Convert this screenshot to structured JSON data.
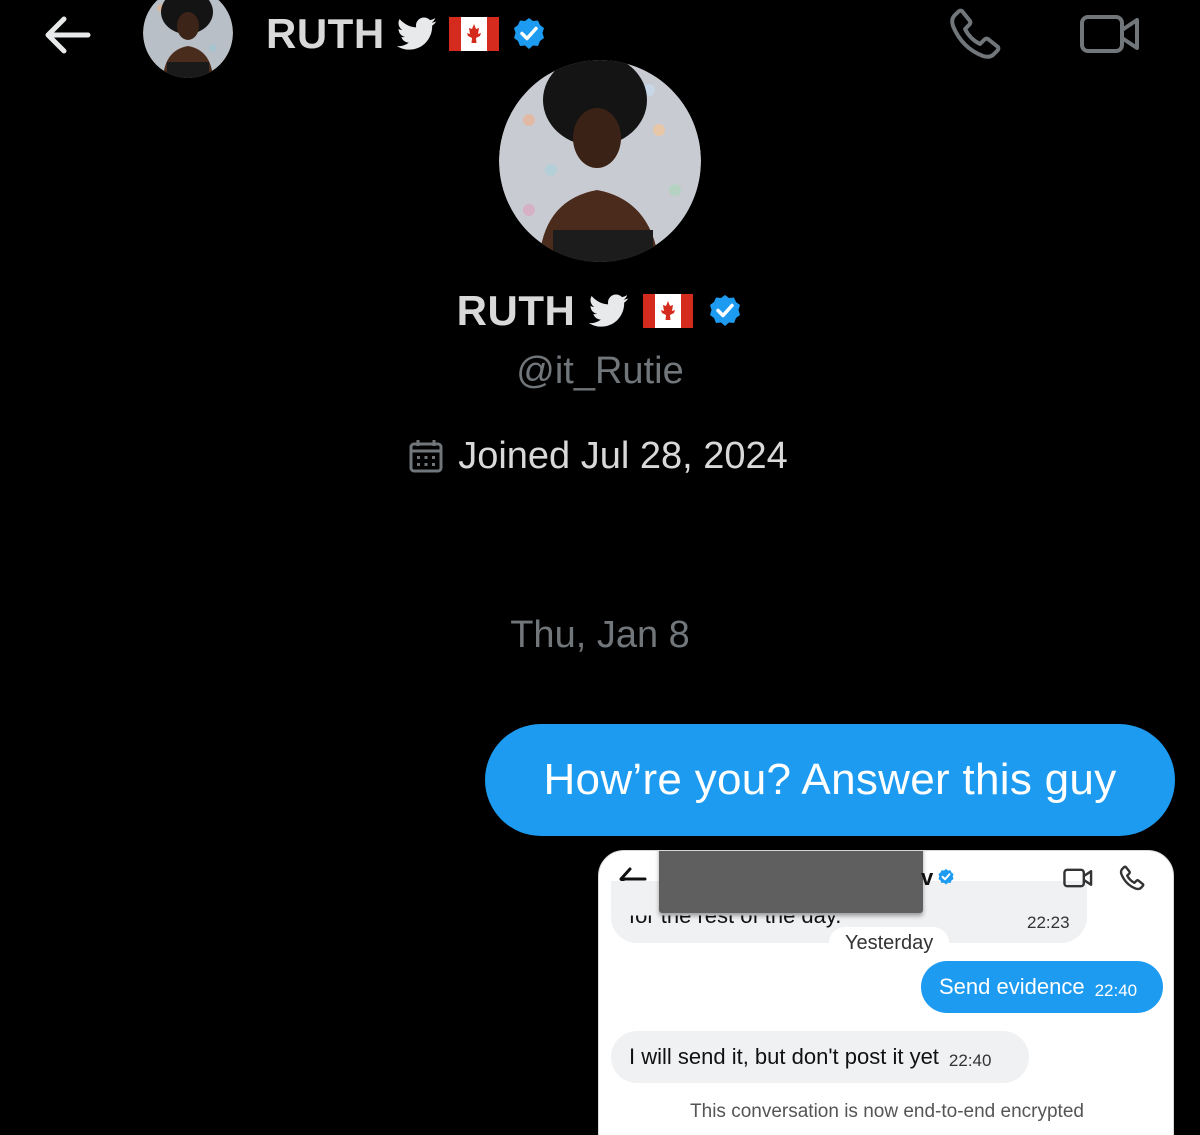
{
  "header": {
    "back_icon": "arrow-left-icon",
    "name": "RUTH",
    "badges": [
      "twitter-bird-icon",
      "canada-flag-icon",
      "verified-badge-icon"
    ],
    "call_icon": "phone-icon",
    "video_icon": "video-camera-icon"
  },
  "profile": {
    "name": "RUTH",
    "handle": "@it_Rutie",
    "joined_icon": "calendar-icon",
    "joined": "Joined Jul 28, 2024"
  },
  "conversation": {
    "date_separator": "Thu, Jan 8",
    "messages": [
      {
        "direction": "sent",
        "text": "How’re you? Answer this guy"
      }
    ]
  },
  "embedded_screenshot": {
    "name_tail": "v",
    "previous_message_fragment": "for the rest of the day.",
    "previous_message_time": "22:23",
    "day_separator": "Yesterday",
    "sent_message": {
      "text": "Send evidence",
      "time": "22:40"
    },
    "received_message": {
      "text": "I will send it, but don't post it yet",
      "time": "22:40"
    },
    "footer_notice": "This conversation is now end-to-end encrypted"
  },
  "colors": {
    "background": "#000000",
    "accent_blue": "#1d9bf0",
    "muted_text": "#71767b",
    "flag_red": "#d52b1e"
  }
}
